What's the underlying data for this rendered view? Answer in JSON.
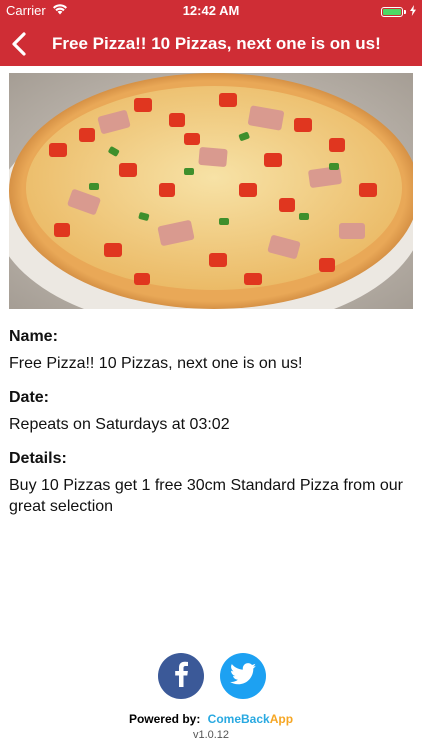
{
  "status_bar": {
    "carrier": "Carrier",
    "time": "12:42 AM",
    "battery_level": 1.0
  },
  "nav": {
    "title": "Free Pizza!! 10 Pizzas, next one is on us!",
    "back_icon": "chevron-left-icon"
  },
  "hero_image": {
    "description_icon": "pizza-photo"
  },
  "details": {
    "name_label": "Name:",
    "name_value": "Free Pizza!! 10 Pizzas, next one is on us!",
    "date_label": "Date:",
    "date_value": "Repeats on Saturdays at 03:02",
    "details_label": "Details:",
    "details_value": "Buy 10 Pizzas get 1 free 30cm Standard Pizza from our great selection"
  },
  "footer": {
    "facebook_icon": "facebook-icon",
    "twitter_icon": "twitter-icon",
    "powered_by": "Powered by:",
    "brand_come": "Come",
    "brand_back": "Back",
    "brand_app": "App",
    "version": "v1.0.12"
  },
  "colors": {
    "accent": "#cf2d35",
    "facebook": "#3b5998",
    "twitter": "#1da1f2",
    "brand_blue": "#29a9e1",
    "brand_orange": "#f6a623"
  }
}
